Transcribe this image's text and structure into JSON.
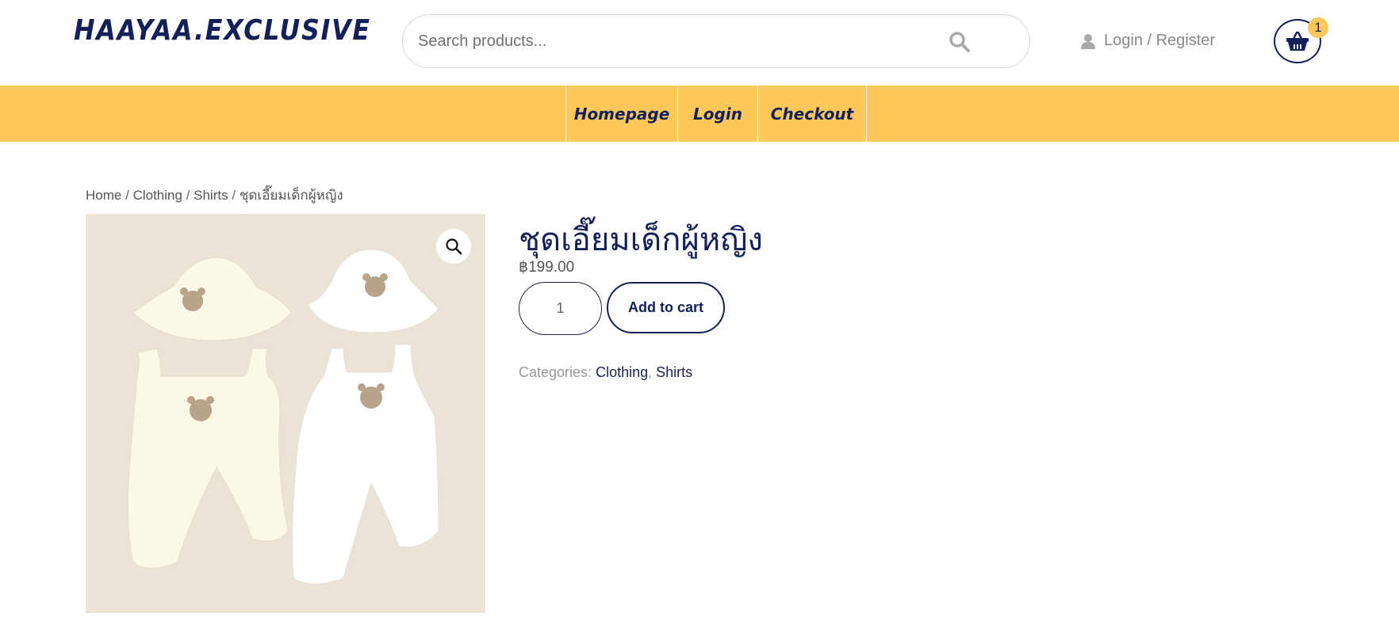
{
  "header": {
    "logo": "HAAYAA.EXCLUSIVE",
    "search_placeholder": "Search products...",
    "login_label": "Login / Register",
    "cart_count": "1"
  },
  "nav": {
    "items": [
      "Homepage",
      "Login",
      "Checkout"
    ]
  },
  "breadcrumb": {
    "items": [
      "Home",
      "Clothing",
      "Shirts"
    ],
    "current": "ชุดเอี๊ยมเด็กผู้หญิง"
  },
  "product": {
    "title": "ชุดเอี๊ยมเด็กผู้หญิง",
    "price": "฿199.00",
    "quantity": "1",
    "add_to_cart": "Add to cart",
    "categories_label": "Categories:",
    "categories": [
      "Clothing",
      "Shirts"
    ]
  },
  "colors": {
    "accent": "#fcc85c",
    "brand": "#13205a"
  }
}
